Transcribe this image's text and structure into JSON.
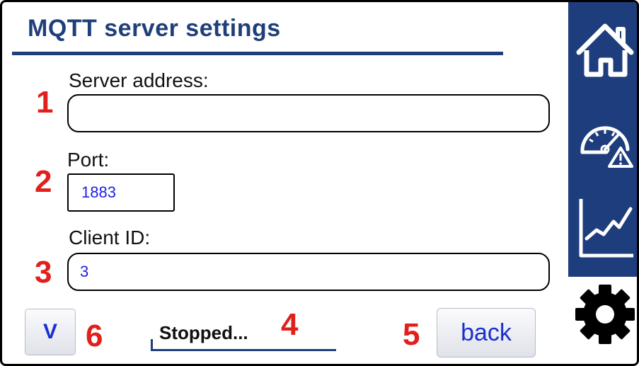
{
  "header": {
    "title": "MQTT server settings"
  },
  "fields": {
    "server_address": {
      "label": "Server address:",
      "value": "",
      "marker": "1"
    },
    "port": {
      "label": "Port:",
      "value": "1883",
      "marker": "2"
    },
    "client_id": {
      "label": "Client ID:",
      "value": "3",
      "marker": "3"
    }
  },
  "status": {
    "text": "Stopped...",
    "marker": "4"
  },
  "back_button": {
    "label": "back",
    "marker": "5"
  },
  "v_button": {
    "label": "V",
    "marker": "6"
  },
  "sidebar": {
    "items": [
      {
        "icon": "home-icon"
      },
      {
        "icon": "gauge-warning-icon"
      },
      {
        "icon": "line-chart-icon"
      },
      {
        "icon": "gear-icon",
        "active": true
      }
    ]
  },
  "colors": {
    "title": "#1f3f7a",
    "sidebar": "#1e3d7d",
    "marker": "#e0201c",
    "value_text": "#2020e8"
  }
}
